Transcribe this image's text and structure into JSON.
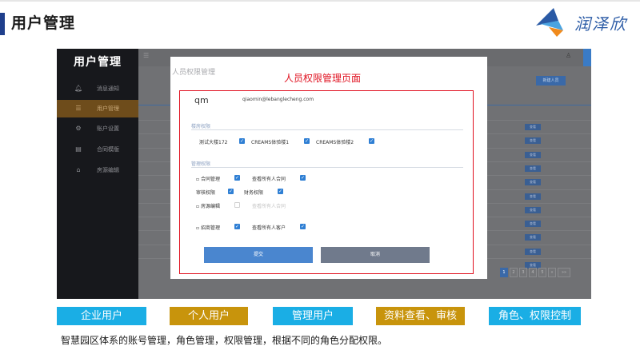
{
  "page": {
    "title": "用户管理",
    "logo_text": "润泽欣",
    "caption": "智慧园区体系的账号管理，角色管理，权限管理，根据不同的角色分配权限。"
  },
  "colors": {
    "title_bar": "#1f3f8c",
    "annotation_red": "#e0101f",
    "tag_cyan": "#1aaee5",
    "tag_gold": "#c8940c",
    "logo_blue": "#2a5aa5",
    "logo_orange": "#f08a1c"
  },
  "sidebar": {
    "title": "用户管理",
    "items": [
      {
        "icon": "bell-icon",
        "label": "消息通知",
        "active": false
      },
      {
        "icon": "user-icon",
        "label": "用户管理",
        "active": true
      },
      {
        "icon": "settings-icon",
        "label": "账户设置",
        "active": false
      },
      {
        "icon": "document-icon",
        "label": "合同模版",
        "active": false
      },
      {
        "icon": "building-icon",
        "label": "房源编辑",
        "active": false
      }
    ]
  },
  "main": {
    "add_button": "新建人员",
    "view_button": "查看",
    "pagination": [
      "1",
      "2",
      "3",
      "4",
      "5",
      "»",
      "»»"
    ],
    "current_page": "1"
  },
  "modal": {
    "title": "人员权限管理",
    "annotation": "人员权限管理页面",
    "user_short": "qm",
    "email": "qiaomin@lebanglecheng.com",
    "building_section": "楼房权限",
    "buildings": [
      {
        "label": "测试大楼172",
        "checked": true
      },
      {
        "label": "CREAMS体验楼1",
        "checked": true
      },
      {
        "label": "CREAMS体验楼2",
        "checked": true
      }
    ],
    "manage_section": "管理权限",
    "permissions": {
      "contract": {
        "label": "合同管理",
        "checked": true
      },
      "view_all_contracts": {
        "label": "查看所有人合同",
        "checked": true
      },
      "audit": {
        "label": "审核权限",
        "checked": true
      },
      "finance": {
        "label": "财务权限",
        "checked": true
      },
      "house_edit": {
        "label": "房源编辑",
        "checked": false
      },
      "view_all_contracts_2": {
        "label": "查看所有人合同",
        "checked": false
      },
      "recruit": {
        "label": "招商管理",
        "checked": true
      },
      "view_all_clients": {
        "label": "查看所有人客户",
        "checked": true
      }
    },
    "submit": "提交",
    "cancel": "取消"
  },
  "tags": [
    {
      "label": "企业用户",
      "color": "#1aaee5"
    },
    {
      "label": "个人用户",
      "color": "#c8940c"
    },
    {
      "label": "管理用户",
      "color": "#1aaee5"
    },
    {
      "label": "资料查看、审核",
      "color": "#c8940c"
    },
    {
      "label": "角色、权限控制",
      "color": "#1aaee5"
    }
  ]
}
